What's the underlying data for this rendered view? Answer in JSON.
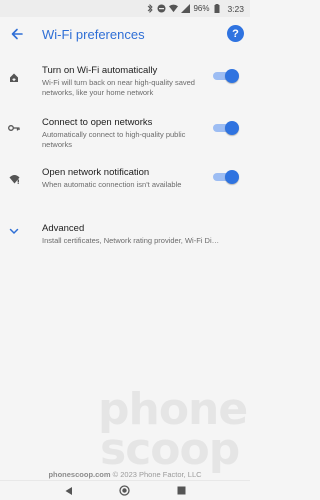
{
  "status": {
    "battery": "96%",
    "time": "3:23"
  },
  "header": {
    "title": "Wi-Fi preferences",
    "help_label": "?"
  },
  "settings": [
    {
      "title": "Turn on Wi-Fi automatically",
      "subtitle": "Wi-Fi will turn back on near high-quality saved networks, like your home network",
      "icon": "wifi-home-icon",
      "toggle_on": true
    },
    {
      "title": "Connect to open networks",
      "subtitle": "Automatically connect to high-quality public networks",
      "icon": "key-icon",
      "toggle_on": true
    },
    {
      "title": "Open network notification",
      "subtitle": "When automatic connection isn't available",
      "icon": "wifi-notification-icon",
      "toggle_on": true
    }
  ],
  "advanced": {
    "title": "Advanced",
    "subtitle": "Install certificates, Network rating provider, Wi-Fi Di…",
    "icon": "chevron-down-icon"
  },
  "watermark": {
    "line1": "phone",
    "line2": "scoop"
  },
  "credit": {
    "site": "phonescoop.com",
    "copyright": "© 2023 Phone Factor, LLC"
  },
  "colors": {
    "accent": "#2f73e0",
    "title": "#2f6fd6",
    "background": "#f5f5f5"
  }
}
